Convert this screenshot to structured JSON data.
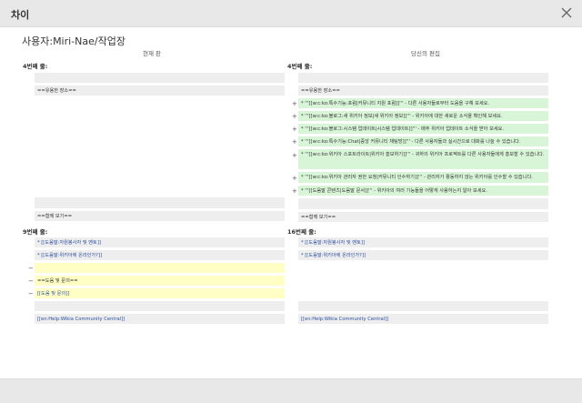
{
  "dialog": {
    "title": "차이"
  },
  "page_title": "사용자:Miri-Nae/작업장",
  "columns": {
    "left": "현재 판",
    "right": "당신의 편집"
  },
  "hunks": [
    {
      "left": "4번째 줄:",
      "right": "4번째 줄:"
    },
    {
      "left": "9번째 줄:",
      "right": "16번째 줄:"
    }
  ],
  "left_lines": [
    "==유용한 장소==",
    "==함께 보기==",
    "* [[도움말:자원봉사자 및 멘토]]",
    "* [[도움말:위키아에 온라인가?]]",
    "==도움 및 문의==",
    "[[도움 및 문의]]",
    "[[en:Help:Wikia Community Central]]"
  ],
  "right_lines": [
    "==유용한 장소==",
    "* '''[[w:c:ko:특수기능:포럼|커뮤니티 지원 포럼]]''' - 다른 사용자들로부터 도움을 구해 보세요.",
    "* '''[[w:c:ko:블로그:새 위키아 정보|새 위키아 정보]]''' - 위키아에 대한 새로운 소식을 확인해 보세요.",
    "* '''[[w:c:ko:블로그:시스템 업데이트|시스템 업데이트]]''' - 매주 위키아 업데이트 소식을 받아 보세요.",
    "* '''[[w:c:ko:특수기능:Chat|중앙 커뮤니티 채팅방]]''' - 다른 사용자들과 실시간으로 대화를 나눌 수 있습니다.",
    "* '''[[w:c:ko:위키아 스포트라이트|위키아 홍보하기]]''' - 귀하의 위키아 프로젝트를 다른 사용자들에게 홍보할 수 있습니다.",
    "* '''[[w:c:ko:위키아 관리자 권한 요청|커뮤니티 인수하기]]''' - 관리자가 활동하지 않는 위키아를 인수할 수 있습니다.",
    "* '''[[도움말 콘텐츠|도움말 문서]]''' - 위키아의 여러 기능들을 어떻게 사용하는지 알아 보세요.",
    "==함께 보기==",
    "* [[도움말:자원봉사자 및 멘토]]",
    "* [[도움말:위키아에 온라인가?]]",
    "[[en:Help:Wikia Community Central]]"
  ],
  "markers": {
    "plus": "+",
    "minus": "−"
  }
}
